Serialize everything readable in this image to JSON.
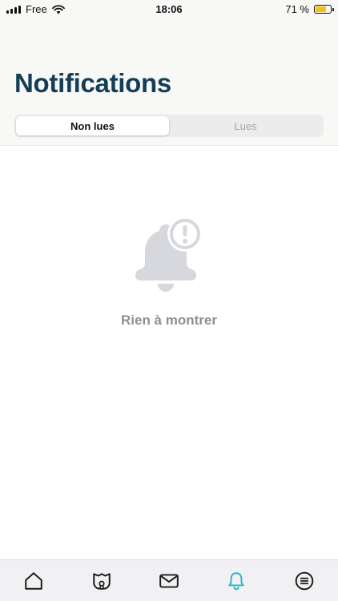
{
  "status_bar": {
    "carrier": "Free",
    "time": "18:06",
    "battery_percent": "71 %",
    "battery_level": 0.71,
    "battery_color": "#f2c317"
  },
  "header": {
    "title": "Notifications",
    "title_color": "#133e56"
  },
  "segments": [
    {
      "label": "Non lues",
      "selected": true
    },
    {
      "label": "Lues",
      "selected": false
    }
  ],
  "empty_state": {
    "icon": "bell-alert-icon",
    "message": "Rien à montrer"
  },
  "tab_bar": {
    "items": [
      {
        "icon": "home-icon",
        "active": false
      },
      {
        "icon": "badge-icon",
        "active": false
      },
      {
        "icon": "mail-icon",
        "active": false
      },
      {
        "icon": "bell-icon",
        "active": true
      },
      {
        "icon": "menu-list-icon",
        "active": false
      }
    ],
    "active_color": "#2ab3c8",
    "inactive_color": "#1a1a1a"
  }
}
